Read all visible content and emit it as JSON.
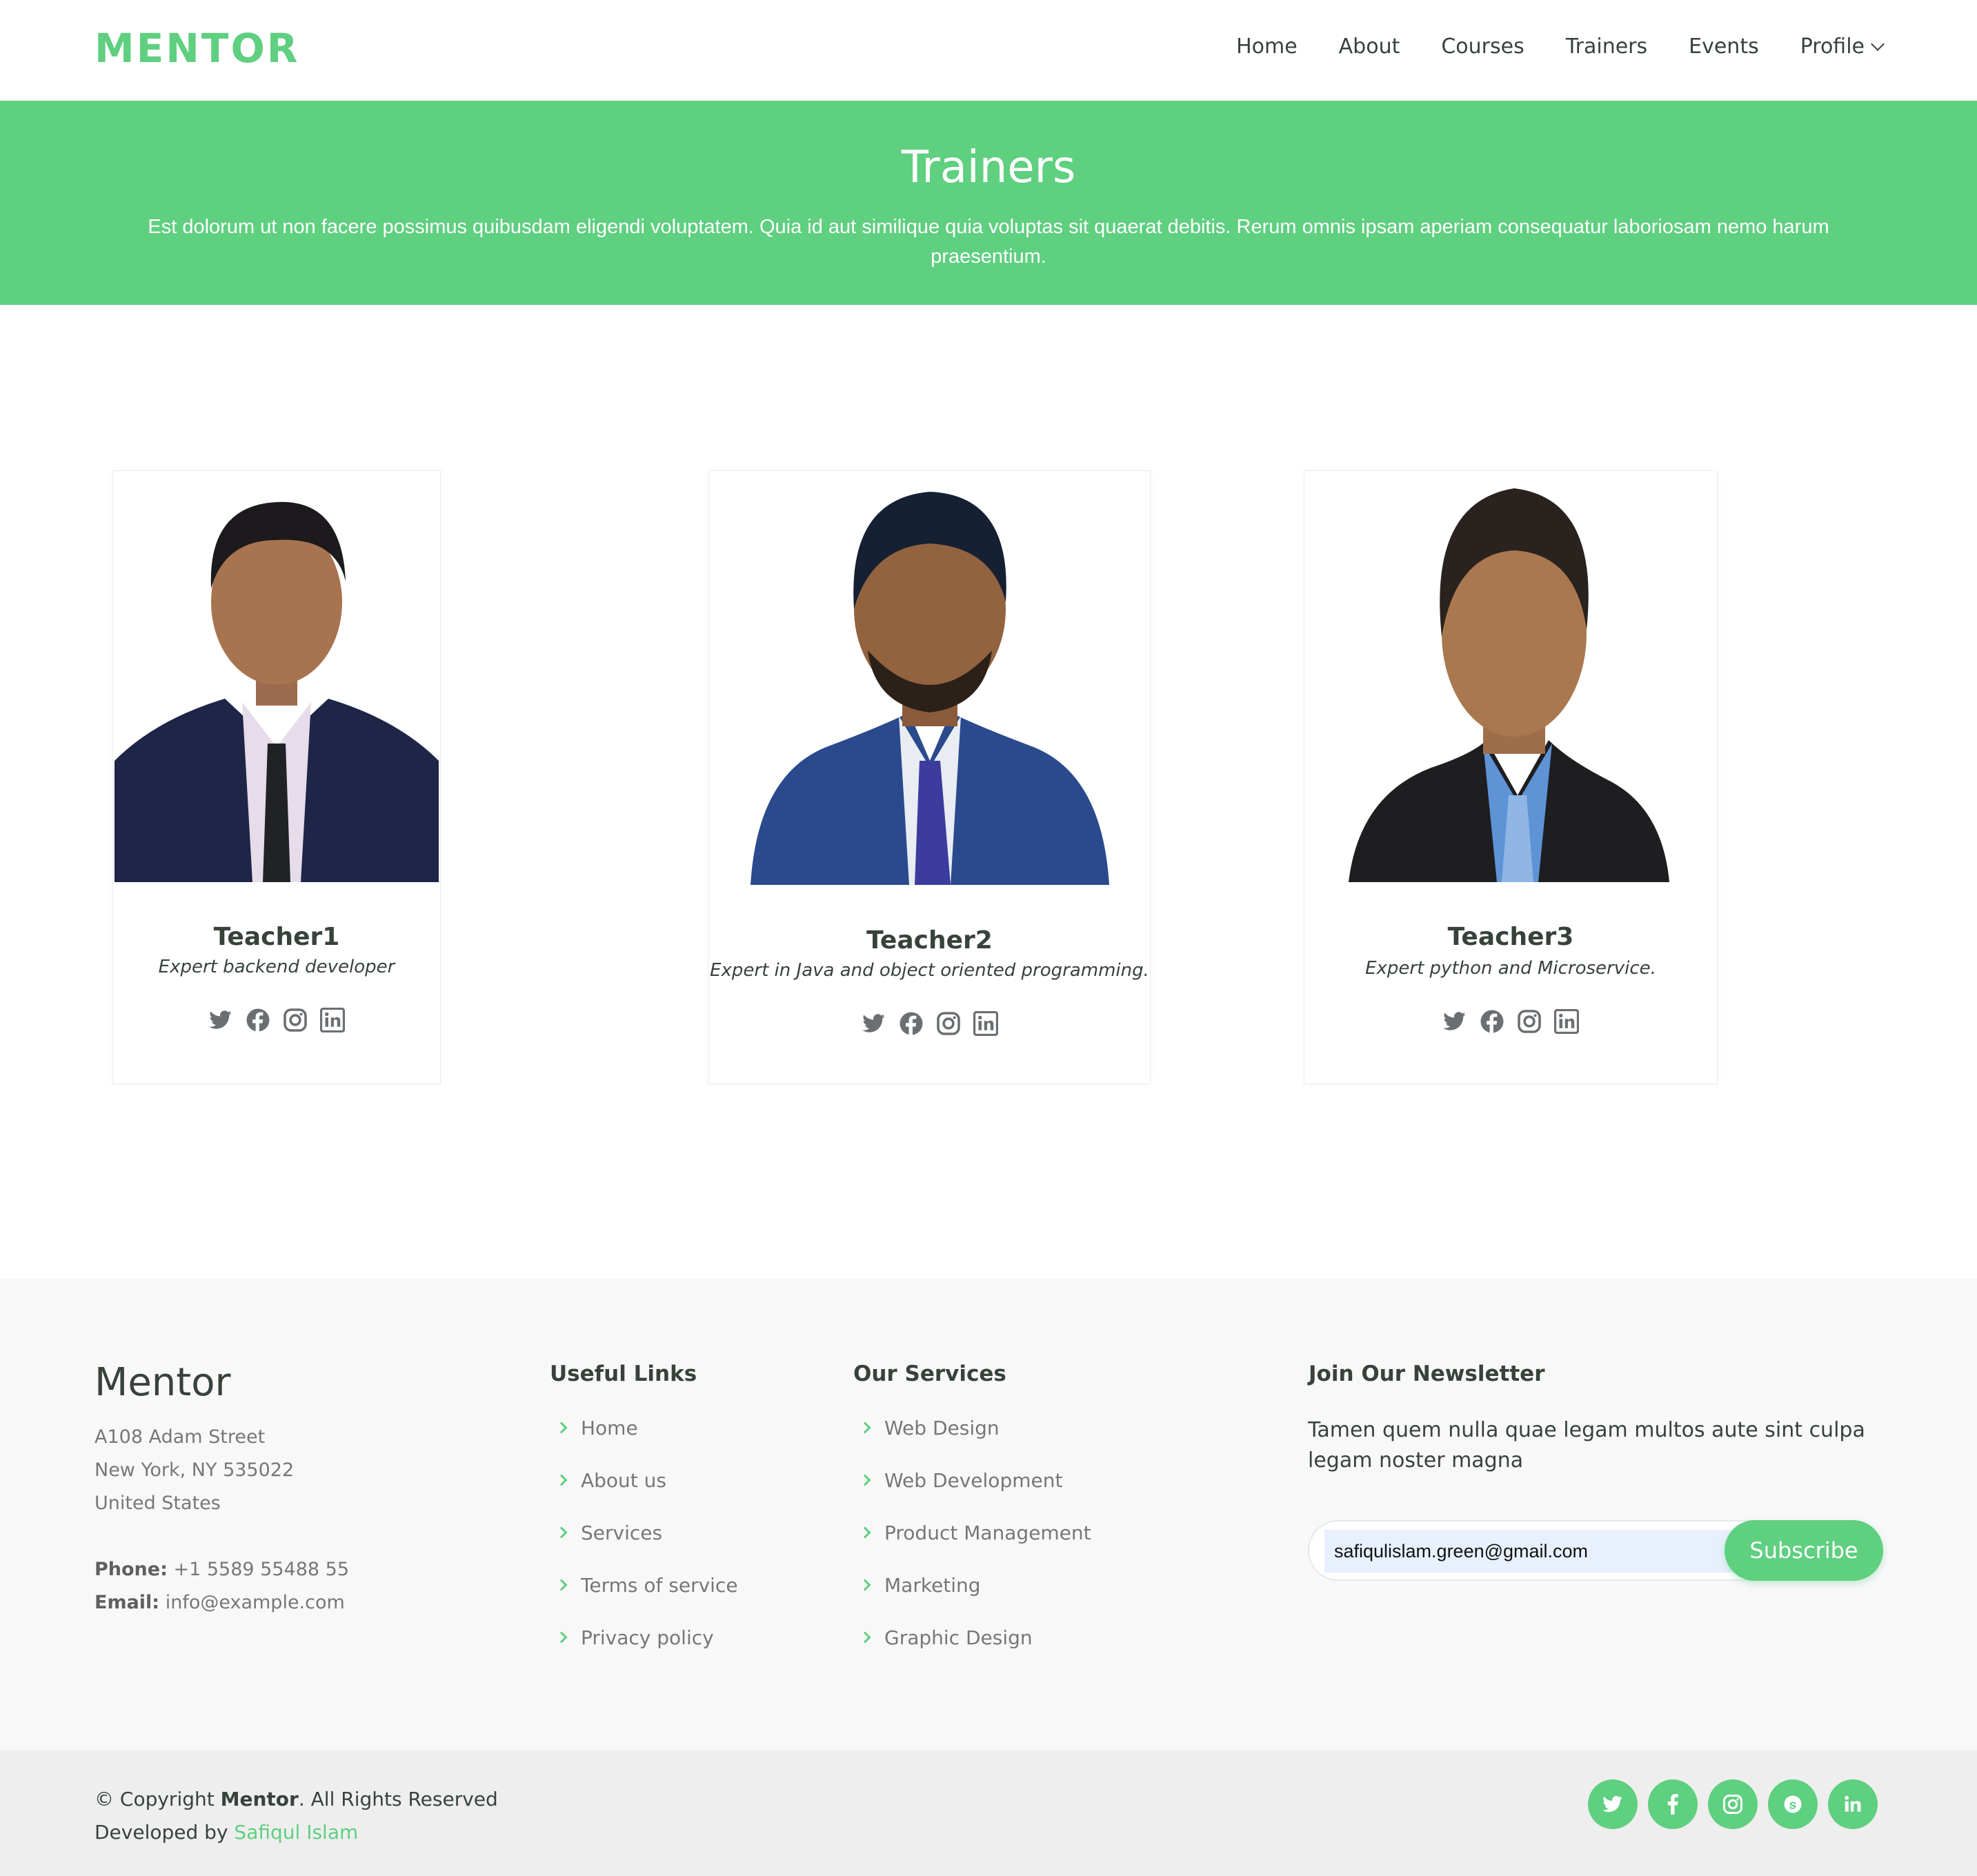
{
  "header": {
    "logo": "MENTOR",
    "nav": [
      "Home",
      "About",
      "Courses",
      "Trainers",
      "Events",
      "Profile"
    ]
  },
  "hero": {
    "title": "Trainers",
    "text": "Est dolorum ut non facere possimus quibusdam eligendi voluptatem. Quia id aut similique quia voluptas sit quaerat debitis. Rerum omnis ipsam aperiam consequatur laboriosam nemo harum praesentium."
  },
  "trainers": [
    {
      "name": "Teacher1",
      "specialty": "Expert backend developer"
    },
    {
      "name": "Teacher2",
      "specialty": "Expert in Java and object oriented programming."
    },
    {
      "name": "Teacher3",
      "specialty": "Expert python and Microservice."
    }
  ],
  "footer": {
    "brand": "Mentor",
    "address": [
      "A108 Adam Street",
      "New York, NY 535022",
      "United States"
    ],
    "phone_label": "Phone:",
    "phone": "+1 5589 55488 55",
    "email_label": "Email:",
    "email": "info@example.com",
    "useful_links_title": "Useful Links",
    "useful_links": [
      "Home",
      "About us",
      "Services",
      "Terms of service",
      "Privacy policy"
    ],
    "services_title": "Our Services",
    "services": [
      "Web Design",
      "Web Development",
      "Product Management",
      "Marketing",
      "Graphic Design"
    ],
    "newsletter_title": "Join Our Newsletter",
    "newsletter_text": "Tamen quem nulla quae legam multos aute sint culpa legam noster magna",
    "newsletter_value": "safiqulislam.green@gmail.com",
    "subscribe_label": "Subscribe",
    "copyright_prefix": "© Copyright",
    "copyright_brand": "Mentor",
    "copyright_suffix": ". All Rights Reserved",
    "developed_prefix": "Developed by",
    "developer": "Safiqul Islam"
  },
  "colors": {
    "accent": "#5fcf80",
    "text": "#37423b",
    "muted": "#777777"
  }
}
